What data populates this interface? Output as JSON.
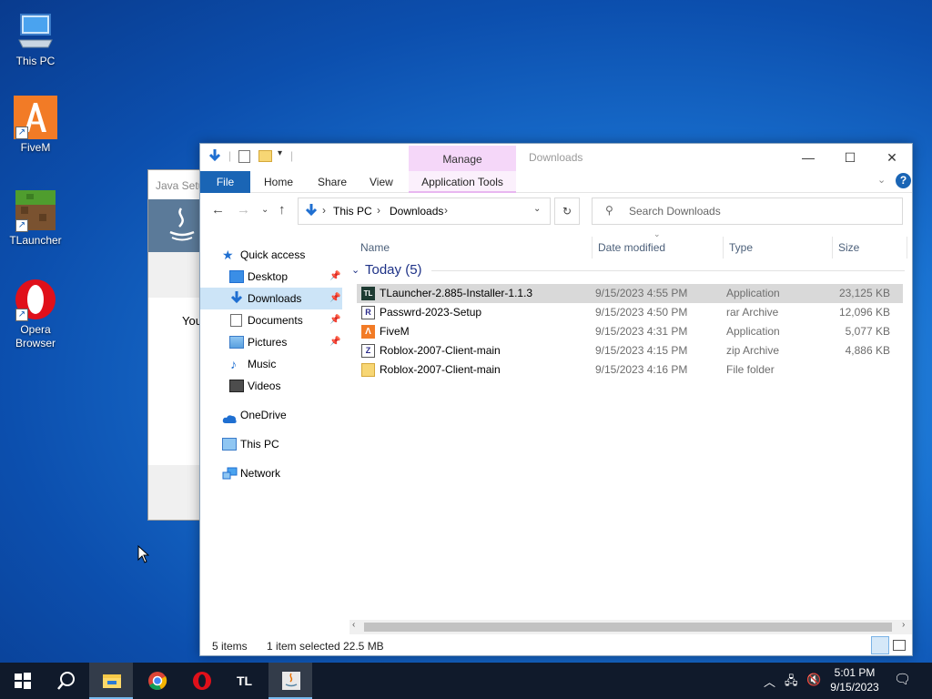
{
  "desktop": {
    "icons": [
      {
        "label": "This PC",
        "icon": "computer-icon"
      },
      {
        "label": "FiveM",
        "icon": "fivem-icon"
      },
      {
        "label": "TLauncher",
        "icon": "tlauncher-icon"
      },
      {
        "label": "Opera Browser",
        "icon": "opera-icon"
      }
    ]
  },
  "java_window": {
    "title": "Java Setu",
    "body_text": "You"
  },
  "explorer": {
    "contextual_tab": "Manage",
    "title": "Downloads",
    "ribbon_tabs": [
      "File",
      "Home",
      "Share",
      "View",
      "Application Tools"
    ],
    "address": {
      "segments": [
        "This PC",
        "Downloads"
      ]
    },
    "search_placeholder": "Search Downloads",
    "nav": [
      {
        "label": "Quick access",
        "icon": "star-icon"
      },
      {
        "label": "Desktop",
        "icon": "desktop-folder-icon",
        "pinned": true
      },
      {
        "label": "Downloads",
        "icon": "download-arrow-icon",
        "pinned": true,
        "selected": true
      },
      {
        "label": "Documents",
        "icon": "documents-icon",
        "pinned": true
      },
      {
        "label": "Pictures",
        "icon": "pictures-icon",
        "pinned": true
      },
      {
        "label": "Music",
        "icon": "music-icon"
      },
      {
        "label": "Videos",
        "icon": "videos-icon"
      },
      {
        "label": "OneDrive",
        "icon": "cloud-icon"
      },
      {
        "label": "This PC",
        "icon": "computer-icon"
      },
      {
        "label": "Network",
        "icon": "network-icon"
      }
    ],
    "columns": [
      "Name",
      "Date modified",
      "Type",
      "Size"
    ],
    "group_label": "Today (5)",
    "files": [
      {
        "name": "TLauncher-2.885-Installer-1.1.3",
        "date": "9/15/2023 4:55 PM",
        "type": "Application",
        "size": "23,125 KB",
        "icon": "tlauncher-icon",
        "selected": true
      },
      {
        "name": "Passwrd-2023-Setup",
        "date": "9/15/2023 4:50 PM",
        "type": "rar Archive",
        "size": "12,096 KB",
        "icon": "rar-archive-icon"
      },
      {
        "name": "FiveM",
        "date": "9/15/2023 4:31 PM",
        "type": "Application",
        "size": "5,077 KB",
        "icon": "fivem-icon"
      },
      {
        "name": "Roblox-2007-Client-main",
        "date": "9/15/2023 4:15 PM",
        "type": "zip Archive",
        "size": "4,886 KB",
        "icon": "zip-archive-icon"
      },
      {
        "name": "Roblox-2007-Client-main",
        "date": "9/15/2023 4:16 PM",
        "type": "File folder",
        "size": "",
        "icon": "folder-icon"
      }
    ],
    "status": {
      "items": "5 items",
      "selected": "1 item selected",
      "size": "22.5 MB"
    }
  },
  "taskbar": {
    "pinned": [
      "start-icon",
      "search-icon",
      "file-explorer-icon",
      "chrome-icon",
      "opera-icon",
      "tlauncher-icon",
      "java-icon"
    ],
    "tl_label": "TL",
    "time": "5:01 PM",
    "date": "9/15/2023"
  },
  "colors": {
    "ribbon_file": "#1a65b5",
    "manage_tab": "#f5d7f9",
    "selection": "#cce4f7",
    "taskbar": "#101a2b"
  }
}
